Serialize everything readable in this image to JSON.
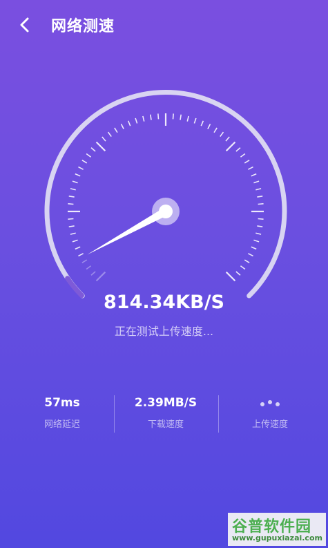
{
  "header": {
    "title": "网络测速",
    "back_icon": "chevron-left-icon"
  },
  "gauge": {
    "progress_fraction": 0.04,
    "needle_fraction": 0.06
  },
  "speed": {
    "value": "814.34KB/S",
    "status": "正在测试上传速度..."
  },
  "stats": [
    {
      "value": "57ms",
      "label": "网络延迟"
    },
    {
      "value": "2.39MB/S",
      "label": "下载速度"
    },
    {
      "value": "",
      "label": "上传速度"
    }
  ],
  "watermark": {
    "logo": "谷普软件园",
    "url": "www.gupuxiazai.com"
  }
}
